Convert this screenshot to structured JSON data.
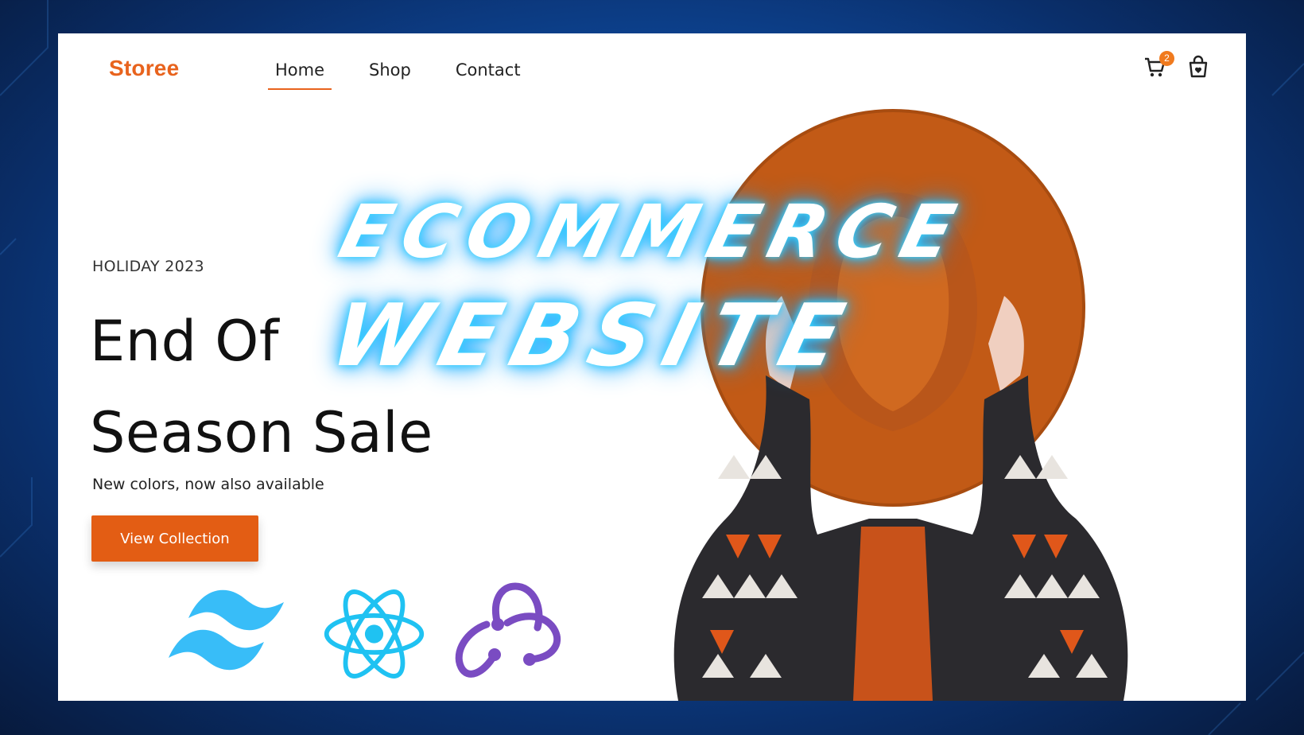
{
  "brand": {
    "name": "Storee",
    "color": "#e8631d"
  },
  "nav": {
    "items": [
      {
        "label": "Home",
        "active": true
      },
      {
        "label": "Shop",
        "active": false
      },
      {
        "label": "Contact",
        "active": false
      }
    ]
  },
  "header_icons": {
    "cart_icon": "cart-icon",
    "cart_count": "2",
    "bag_icon": "shopping-bag-heart-icon"
  },
  "hero": {
    "eyebrow": "HOLIDAY 2023",
    "headline_line1": "End Of",
    "headline_line2": "Season Sale",
    "subtitle": "New colors, now also available",
    "cta_label": "View Collection",
    "cta_color": "#e35d14"
  },
  "overlay": {
    "line1": "ECOMMERCE",
    "line2": "WEBSITE",
    "glow_color": "#40d8ff"
  },
  "tech_logos": [
    "tailwind-logo",
    "react-logo",
    "redux-logo"
  ],
  "colors": {
    "background_blue": "#0f4fa8",
    "accent": "#e8631d"
  }
}
